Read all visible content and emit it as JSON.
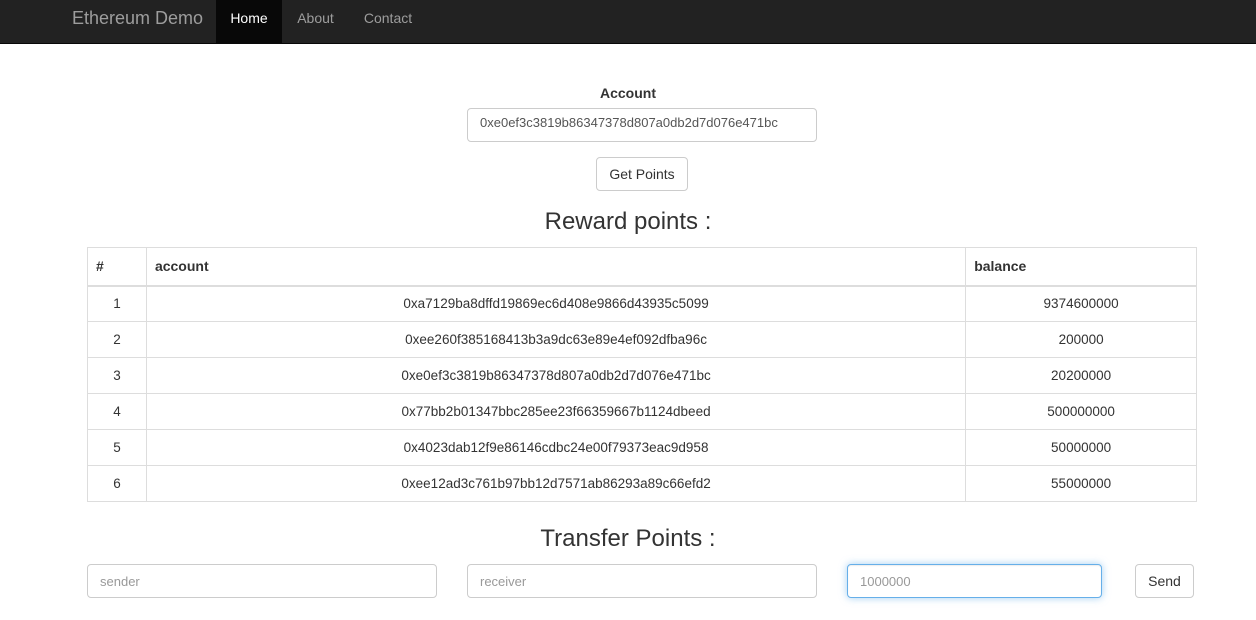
{
  "navbar": {
    "brand": "Ethereum Demo",
    "items": [
      {
        "label": "Home",
        "active": true
      },
      {
        "label": "About",
        "active": false
      },
      {
        "label": "Contact",
        "active": false
      }
    ]
  },
  "account": {
    "label": "Account",
    "value": "0xe0ef3c3819b86347378d807a0db2d7d076e471bc",
    "button_label": "Get Points"
  },
  "reward": {
    "title": "Reward points :",
    "columns": [
      "#",
      "account",
      "balance"
    ],
    "rows": [
      {
        "num": "1",
        "account": "0xa7129ba8dffd19869ec6d408e9866d43935c5099",
        "balance": "9374600000"
      },
      {
        "num": "2",
        "account": "0xee260f385168413b3a9dc63e89e4ef092dfba96c",
        "balance": "200000"
      },
      {
        "num": "3",
        "account": "0xe0ef3c3819b86347378d807a0db2d7d076e471bc",
        "balance": "20200000"
      },
      {
        "num": "4",
        "account": "0x77bb2b01347bbc285ee23f66359667b1124dbeed",
        "balance": "500000000"
      },
      {
        "num": "5",
        "account": "0x4023dab12f9e86146cdbc24e00f79373eac9d958",
        "balance": "50000000"
      },
      {
        "num": "6",
        "account": "0xee12ad3c761b97bb12d7571ab86293a89c66efd2",
        "balance": "55000000"
      }
    ]
  },
  "transfer": {
    "title": "Transfer Points :",
    "sender_placeholder": "sender",
    "receiver_placeholder": "receiver",
    "amount_placeholder": "1000000",
    "send_label": "Send"
  }
}
